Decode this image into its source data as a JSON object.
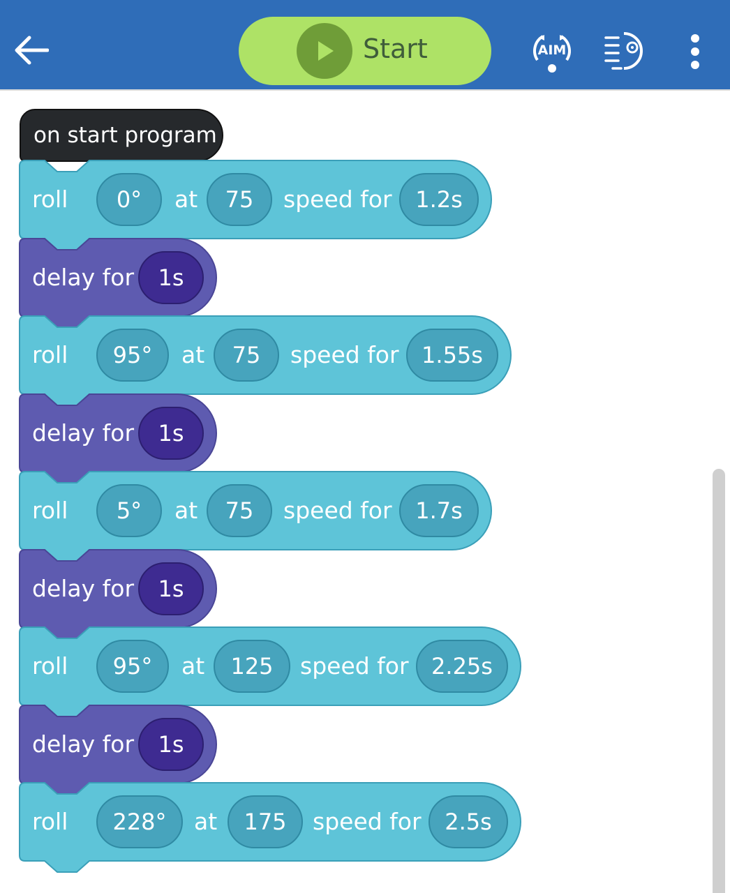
{
  "header": {
    "start_label": "Start",
    "aim_label": "AIM",
    "icons": {
      "back": "back-arrow-icon",
      "play": "play-icon",
      "aim": "aim-icon",
      "drive": "drive-icon",
      "more": "more-vertical-icon"
    },
    "colors": {
      "bar": "#2f6db8",
      "start": "#aee266",
      "play": "#6f9d38"
    }
  },
  "program": {
    "hat_label": "on start program",
    "roll_word": "roll",
    "at_word": "at",
    "speed_for_word": "speed for",
    "delay_word": "delay for",
    "steps": [
      {
        "type": "roll",
        "heading": "0°",
        "speed": "75",
        "duration": "1.2s"
      },
      {
        "type": "delay",
        "duration": "1s"
      },
      {
        "type": "roll",
        "heading": "95°",
        "speed": "75",
        "duration": "1.55s"
      },
      {
        "type": "delay",
        "duration": "1s"
      },
      {
        "type": "roll",
        "heading": "5°",
        "speed": "75",
        "duration": "1.7s"
      },
      {
        "type": "delay",
        "duration": "1s"
      },
      {
        "type": "roll",
        "heading": "95°",
        "speed": "125",
        "duration": "2.25s"
      },
      {
        "type": "delay",
        "duration": "1s"
      },
      {
        "type": "roll",
        "heading": "228°",
        "speed": "175",
        "duration": "2.5s"
      }
    ],
    "colors": {
      "roll": "#5ec4d8",
      "roll_edge": "#3a9fb8",
      "delay": "#5e5bb0",
      "delay_edge": "#4a4696",
      "hat": "#26292c"
    }
  }
}
